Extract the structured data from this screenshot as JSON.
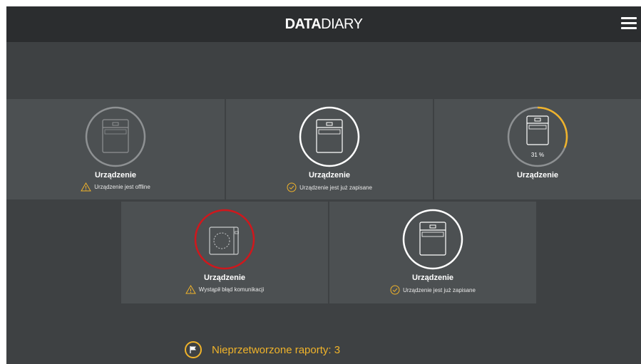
{
  "app": {
    "logo_bold": "DATA",
    "logo_light": "DIARY",
    "menu_icon": "hamburger-menu-icon"
  },
  "devices": [
    {
      "name": "Urządzenie",
      "status": "Urządzenie jest offline",
      "status_icon": "warning-icon",
      "ring_color": "#8e9193",
      "device_icon": "appliance-icon"
    },
    {
      "name": "Urządzenie",
      "status": "Urządzenie jest już zapisane",
      "status_icon": "check-icon",
      "ring_color": "#ffffff",
      "device_icon": "appliance-icon"
    },
    {
      "name": "Urządzenie",
      "progress_label": "31 %",
      "progress": 0.31,
      "ring_color": "#8e9193",
      "progress_color": "#f0b32a",
      "device_icon": "appliance-icon"
    },
    {
      "name": "Urządzenie",
      "status": "Wystąpił błąd komunikacji",
      "status_icon": "warning-icon",
      "ring_color": "#d0171c",
      "device_icon": "washing-machine-icon"
    },
    {
      "name": "Urządzenie",
      "status": "Urządzenie jest już zapisane",
      "status_icon": "check-icon",
      "ring_color": "#ffffff",
      "device_icon": "appliance-icon"
    }
  ],
  "reports": {
    "label": "Nieprzetworzone raporty: 3",
    "icon": "flag-icon",
    "accent": "#f0b32a"
  }
}
